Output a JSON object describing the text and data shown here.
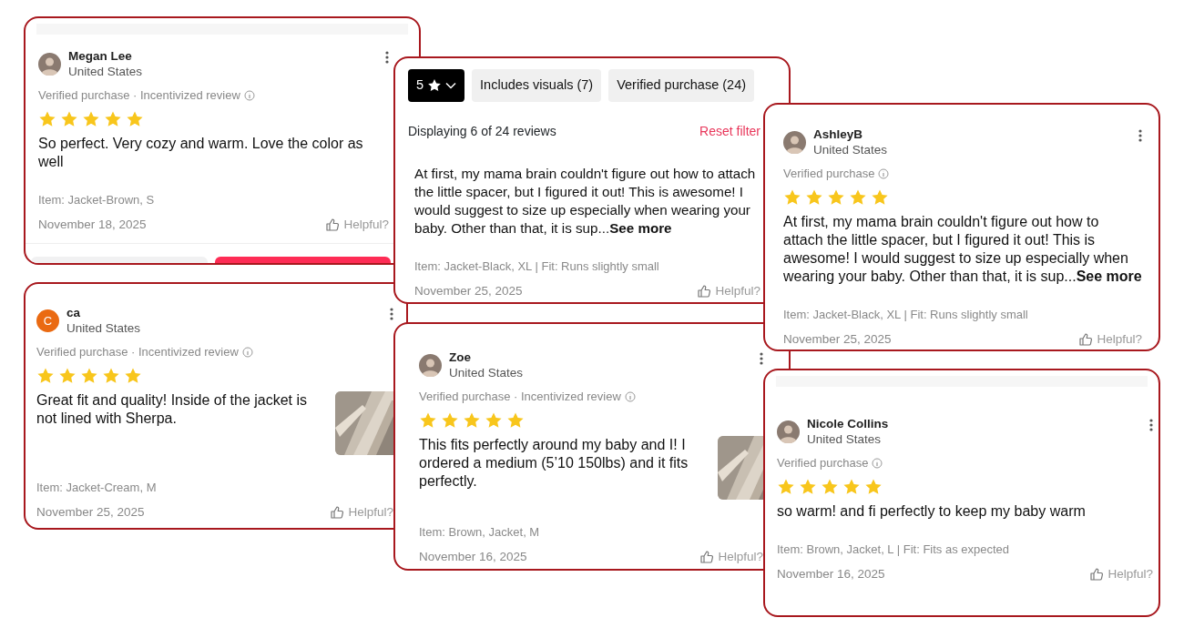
{
  "panels": [
    {
      "kind": "review",
      "review": {
        "name": "Megan Lee",
        "country": "United States",
        "meta": "Verified purchase · Incentivized review",
        "stars": 5,
        "text": "So perfect.  Very cozy and warm. Love the color as well",
        "item": "Item: Jacket-Brown, S",
        "date": "November 18, 2025",
        "helpful": "Helpful?"
      },
      "action_buttons": [
        {
          "kind": "plain"
        },
        {
          "kind": "accent"
        }
      ]
    },
    {
      "kind": "review",
      "review": {
        "name": "ca",
        "country": "United States",
        "avatar": {
          "kind": "letter",
          "letter": "C"
        },
        "meta": "Verified purchase · Incentivized review",
        "stars": 5,
        "text": "Great fit and quality! Inside of the jacket is not lined with Sherpa.",
        "item": "Item: Jacket-Cream, M",
        "date": "November 25, 2025",
        "helpful": "Helpful?"
      }
    },
    {
      "kind": "filtered",
      "filters": [
        {
          "label": "5",
          "selected": true
        },
        {
          "label": "Includes visuals (7)",
          "selected": false
        },
        {
          "label": "Verified purchase (24)",
          "selected": false
        }
      ],
      "summary": "Displaying 6 of 24 reviews",
      "reset": "Reset filter",
      "review": {
        "text": "At first, my mama brain couldn't figure out how to attach the little spacer, but I figured it out! This is awesome! I would suggest to size up especially when wearing your baby. Other than that, it is sup...**See more**",
        "item": "Item: Jacket-Black, XL | Fit: Runs slightly small",
        "date": "November 25, 2025",
        "helpful": "Helpful?"
      }
    },
    {
      "kind": "review",
      "review": {
        "name": "Zoe",
        "country": "United States",
        "meta": "Verified purchase · Incentivized review",
        "stars": 5,
        "text": "This fits perfectly around my baby and I! I ordered a medium (5’10 150lbs) and it fits perfectly.",
        "item": "Item: Brown, Jacket, M",
        "date": "November 16, 2025",
        "helpful": "Helpful?"
      }
    },
    {
      "kind": "review",
      "review": {
        "name": "AshleyB",
        "country": "United States",
        "meta": "Verified purchase",
        "stars": 5,
        "text": "At first, my mama brain couldn't figure out how to attach the little spacer, but I figured it out! This is awesome! I would suggest to size up especially when wearing your baby. Other than that, it is sup...**See more**",
        "item": "Item: Jacket-Black, XL | Fit: Runs slightly small",
        "date": "November 25, 2025",
        "helpful": "Helpful?"
      }
    },
    {
      "kind": "review",
      "review": {
        "name": "Nicole Collins",
        "country": "United States",
        "meta": "Verified purchase",
        "stars": 5,
        "text": "so warm! and fi perfectly to keep my baby warm",
        "item": "Item: Brown, Jacket, L | Fit: Fits as expected",
        "date": "November 16, 2025",
        "helpful": "Helpful?"
      }
    }
  ]
}
